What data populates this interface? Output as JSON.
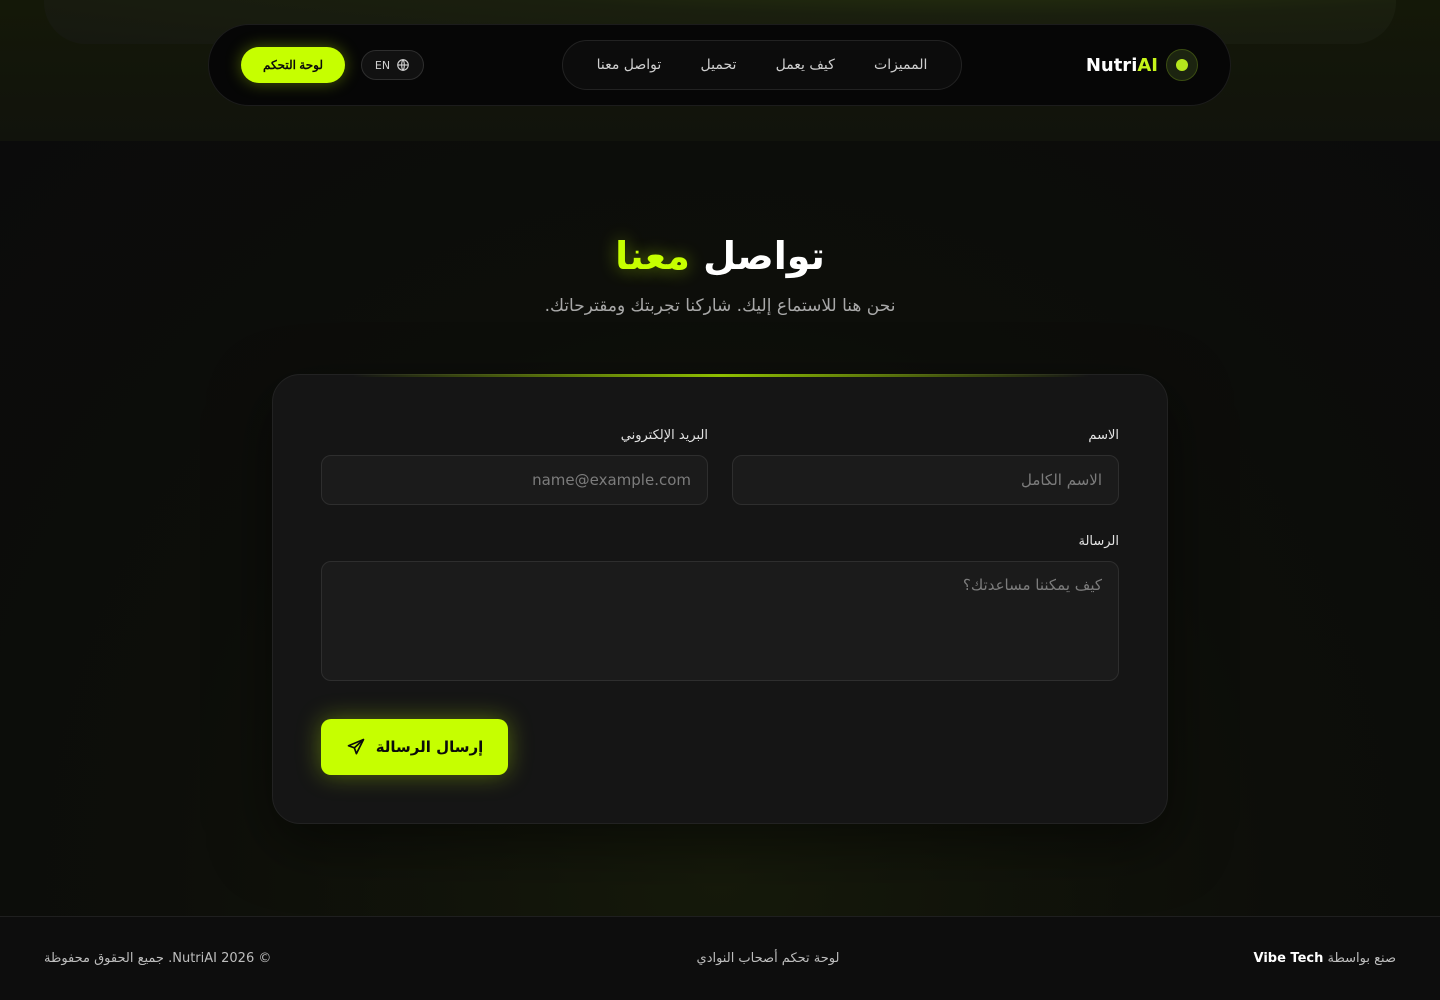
{
  "navbar": {
    "brand": {
      "name_white": "Nutri",
      "name_accent": "AI"
    },
    "links": [
      "المميزات",
      "كيف يعمل",
      "تحميل",
      "تواصل معنا"
    ],
    "lang_label": "EN",
    "dashboard_label": "لوحة التحكم"
  },
  "hero": {
    "title_main": "تواصل",
    "title_accent": "معنا",
    "subtitle": "نحن هنا للاستماع إليك. شاركنا تجربتك ومقترحاتك."
  },
  "form": {
    "name_label": "الاسم",
    "name_placeholder": "الاسم الكامل",
    "email_label": "البريد الإلكتروني",
    "email_placeholder": "name@example.com",
    "message_label": "الرسالة",
    "message_placeholder": "كيف يمكننا مساعدتك؟",
    "submit_label": "إرسال الرسالة"
  },
  "footer": {
    "made_by_prefix": "صنع بواسطة",
    "made_by_name": "Vibe Tech",
    "center_text": "لوحة تحكم أصحاب النوادي",
    "copyright": "© 2026 NutriAI. جميع الحقوق محفوظة"
  },
  "colors": {
    "accent": "#c6ff00",
    "background": "#0b0b0b",
    "card": "#151515"
  }
}
